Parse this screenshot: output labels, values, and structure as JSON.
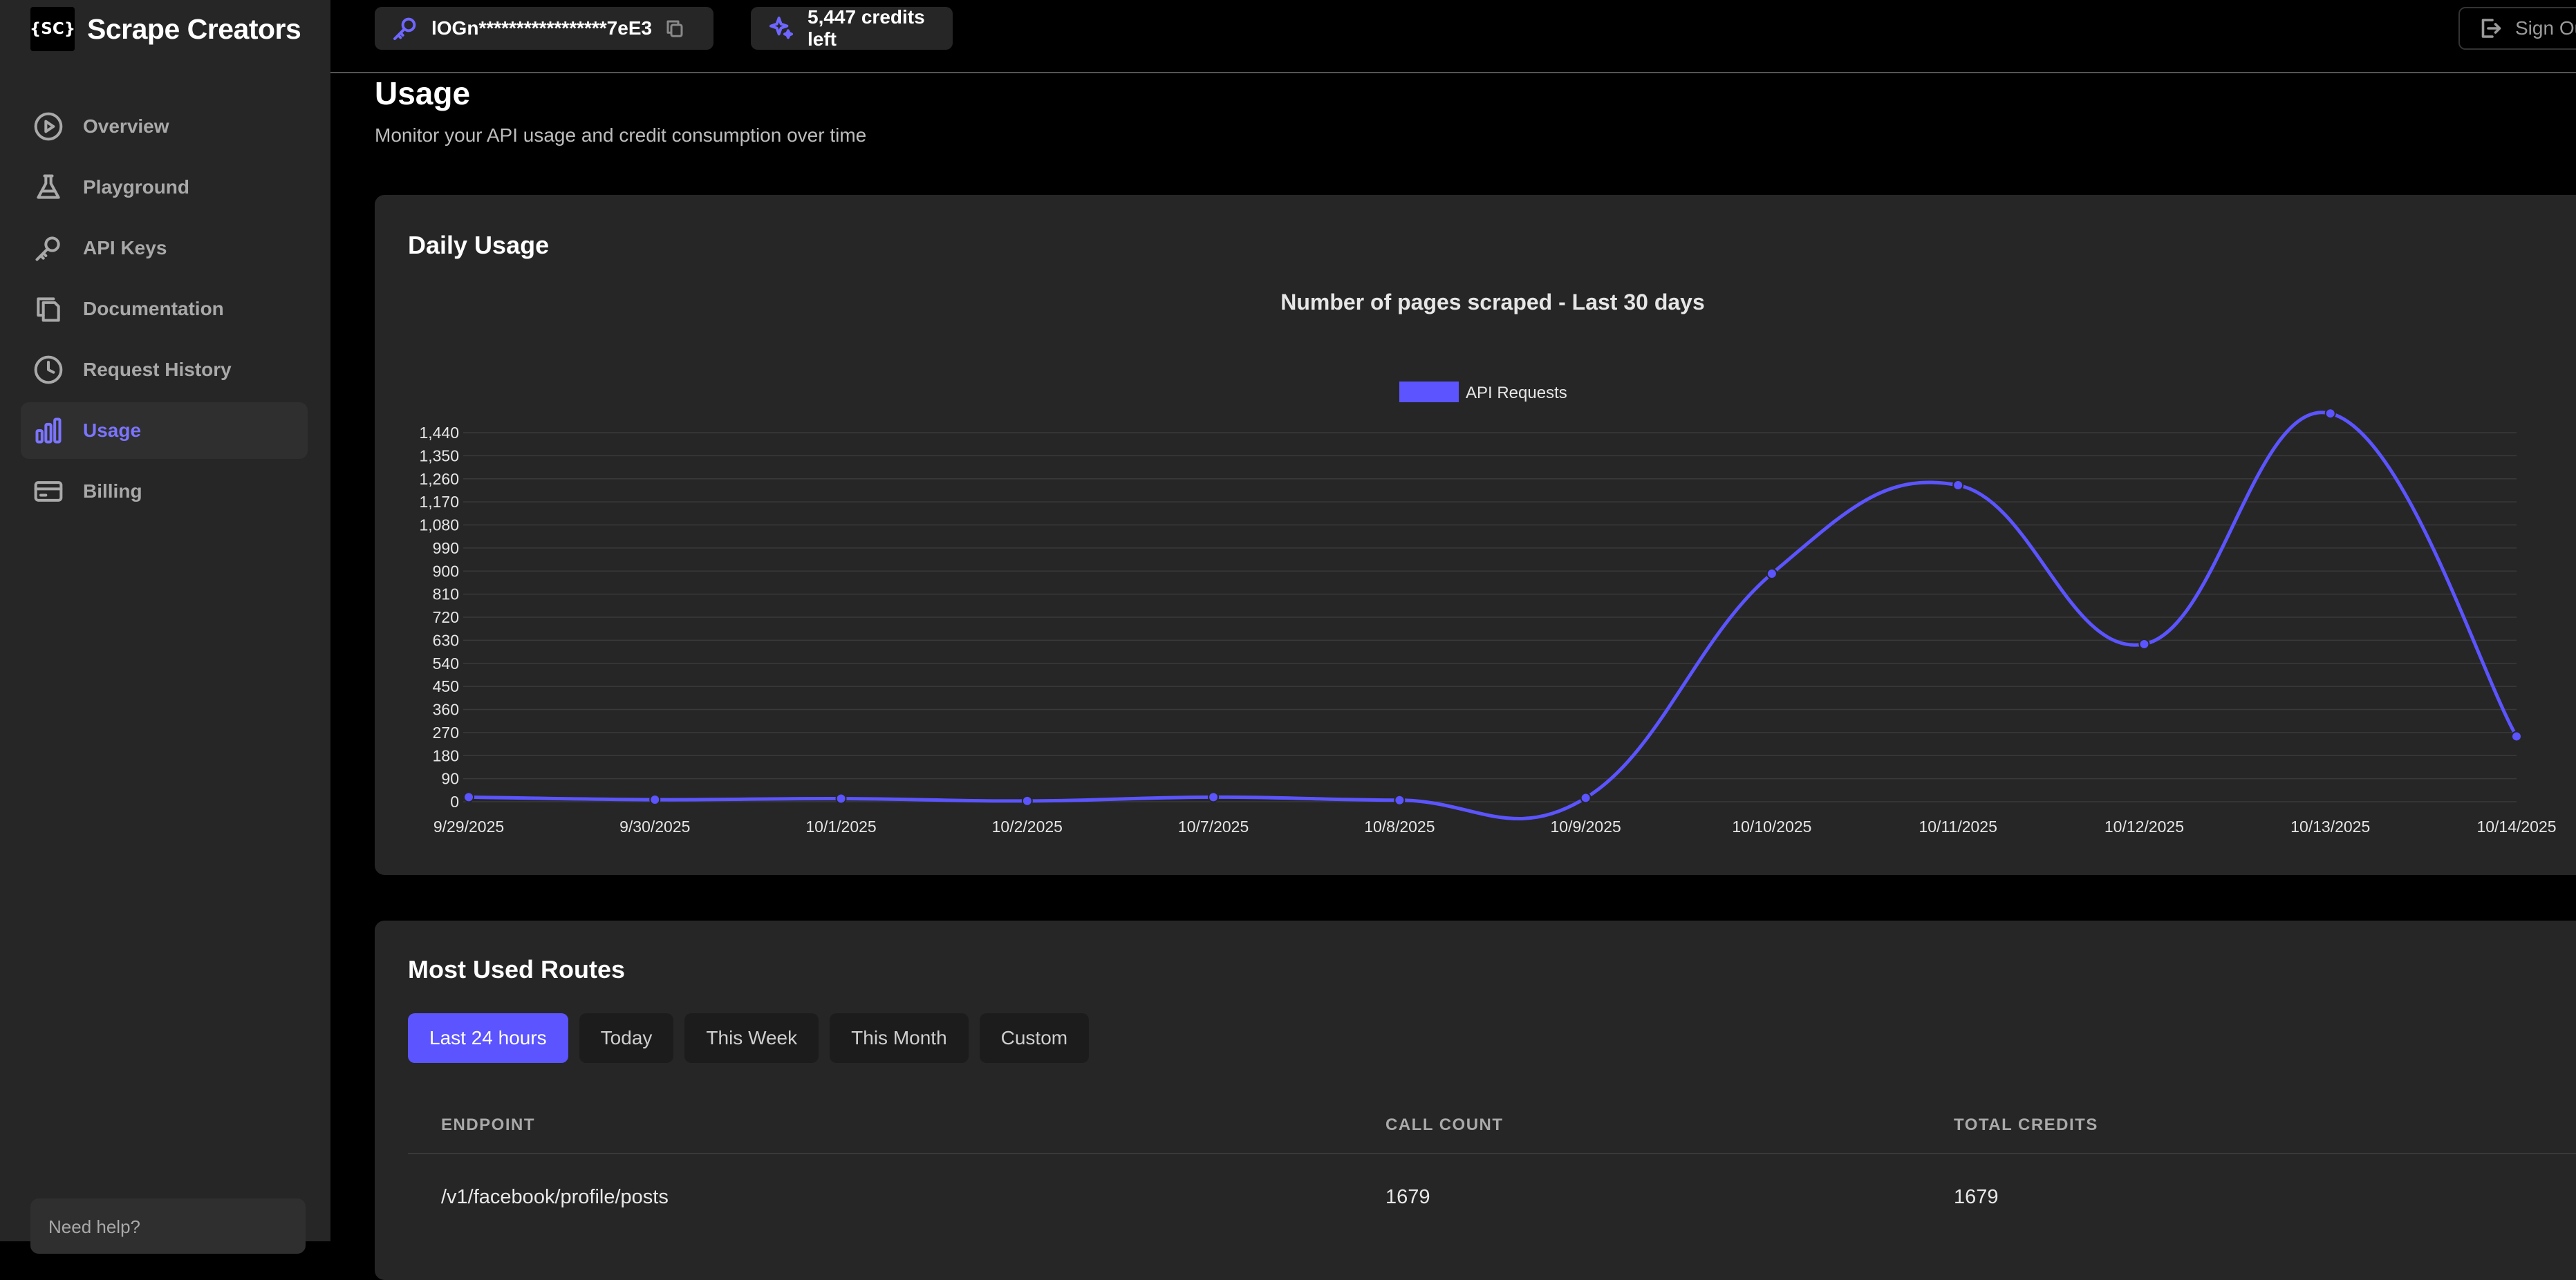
{
  "brand": {
    "logo": "{SC}",
    "name": "Scrape Creators"
  },
  "sidebar": {
    "items": [
      {
        "label": "Overview",
        "icon": "play-circle-icon"
      },
      {
        "label": "Playground",
        "icon": "flask-icon"
      },
      {
        "label": "API Keys",
        "icon": "key-icon"
      },
      {
        "label": "Documentation",
        "icon": "document-icon"
      },
      {
        "label": "Request History",
        "icon": "clock-icon"
      },
      {
        "label": "Usage",
        "icon": "bar-chart-icon",
        "active": true
      },
      {
        "label": "Billing",
        "icon": "credit-card-icon"
      }
    ],
    "help": "Need help?"
  },
  "topbar": {
    "api_key": "lOGn*****************7eE3",
    "credits": "5,447 credits left",
    "sign_out": "Sign Out"
  },
  "page": {
    "title": "Usage",
    "subtitle": "Monitor your API usage and credit consumption over time"
  },
  "daily_usage": {
    "title": "Daily Usage"
  },
  "colors": {
    "accent": "#5b54ff",
    "line": "#5b54ff",
    "card": "#262626",
    "background": "#000000"
  },
  "chart_data": {
    "type": "line",
    "title": "Number of pages scraped - Last 30 days",
    "categories": [
      "9/29/2025",
      "9/30/2025",
      "10/1/2025",
      "10/2/2025",
      "10/7/2025",
      "10/8/2025",
      "10/9/2025",
      "10/10/2025",
      "10/11/2025",
      "10/12/2025",
      "10/13/2025",
      "10/14/2025"
    ],
    "series": [
      {
        "name": "API Requests",
        "values": [
          18,
          8,
          12,
          3,
          18,
          6,
          15,
          890,
          1235,
          615,
          1515,
          255
        ]
      }
    ],
    "yticks": [
      "0",
      "90",
      "180",
      "270",
      "360",
      "450",
      "540",
      "630",
      "720",
      "810",
      "900",
      "990",
      "1,080",
      "1,170",
      "1,260",
      "1,350",
      "1,440"
    ],
    "ylim": [
      0,
      1440
    ],
    "grid": true,
    "legend": "top-center",
    "smooth": true
  },
  "routes": {
    "title": "Most Used Routes",
    "filters": [
      {
        "label": "Last 24 hours",
        "active": true
      },
      {
        "label": "Today"
      },
      {
        "label": "This Week"
      },
      {
        "label": "This Month"
      },
      {
        "label": "Custom"
      }
    ],
    "columns": [
      "ENDPOINT",
      "CALL COUNT",
      "TOTAL CREDITS"
    ],
    "rows": [
      [
        "/v1/facebook/profile/posts",
        "1679",
        "1679"
      ]
    ]
  }
}
